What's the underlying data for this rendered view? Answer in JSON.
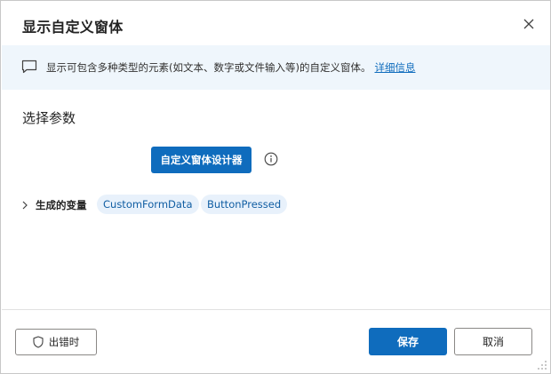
{
  "dialog": {
    "title": "显示自定义窗体",
    "close_icon": "close-icon"
  },
  "info_bar": {
    "icon": "message-icon",
    "text": "显示可包含多种类型的元素(如文本、数字或文件输入等)的自定义窗体。",
    "link": "详细信息"
  },
  "parameters": {
    "section_title": "选择参数",
    "designer_button": "自定义窗体设计器",
    "info_icon": "info-icon"
  },
  "generated_vars": {
    "label": "生成的变量",
    "chips": [
      "CustomFormData",
      "ButtonPressed"
    ]
  },
  "footer": {
    "on_error": "出错时",
    "save": "保存",
    "cancel": "取消"
  },
  "colors": {
    "accent": "#0f6cbd",
    "info_bg": "#eff6fc",
    "chip_bg": "#e8f1fb"
  }
}
